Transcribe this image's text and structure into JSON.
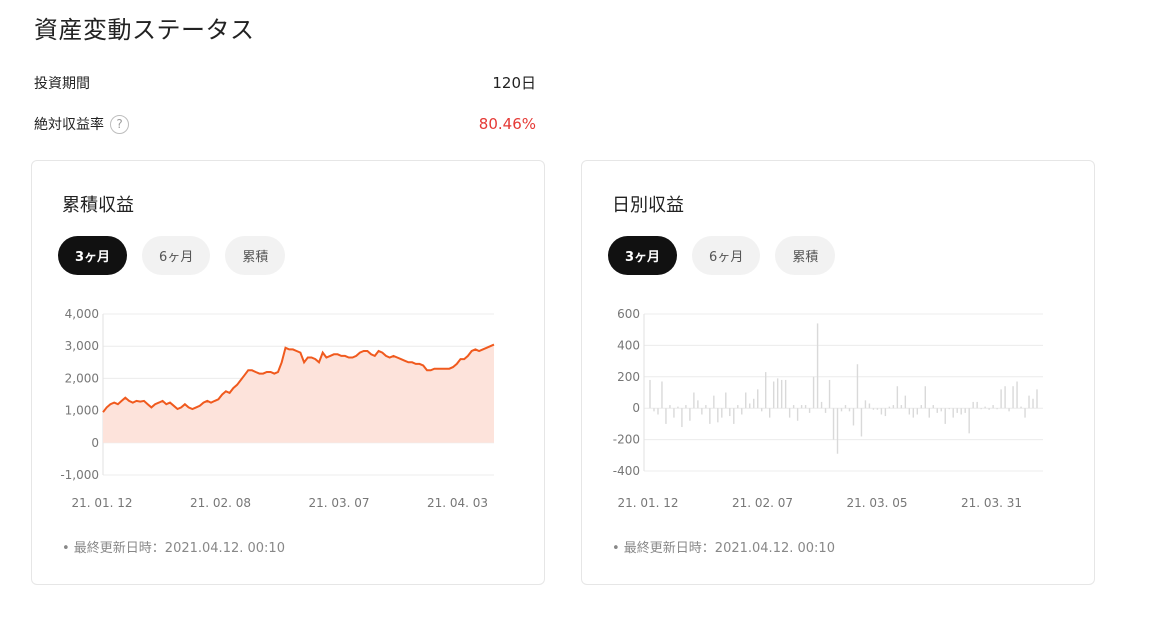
{
  "page_title": "資産変動ステータス",
  "summary": {
    "period_label": "投資期間",
    "period_value": "120日",
    "return_label": "絶対収益率",
    "return_help": "?",
    "return_value": "80.46%"
  },
  "tabs": [
    "3ヶ月",
    "6ヶ月",
    "累積"
  ],
  "left_card": {
    "title": "累積収益",
    "active_tab": "3ヶ月",
    "footnote": "• 最終更新日時：2021.04.12. 00:10"
  },
  "right_card": {
    "title": "日別収益",
    "active_tab": "3ヶ月",
    "footnote": "• 最終更新日時：2021.04.12. 00:10"
  },
  "chart_data": [
    {
      "type": "area",
      "ylim": [
        -1000,
        4000
      ],
      "y_ticks": [
        "4,000",
        "3,000",
        "2,000",
        "1,000",
        "0",
        "-1,000"
      ],
      "x_ticks": [
        "21. 01. 12",
        "21. 02. 08",
        "21. 03. 07",
        "21. 04. 03"
      ],
      "color": "#f05a1e",
      "fill": "#fde3db",
      "values": [
        950,
        1100,
        1200,
        1250,
        1200,
        1300,
        1400,
        1300,
        1250,
        1300,
        1280,
        1300,
        1200,
        1100,
        1200,
        1250,
        1300,
        1200,
        1250,
        1150,
        1050,
        1100,
        1200,
        1100,
        1050,
        1100,
        1150,
        1250,
        1300,
        1250,
        1300,
        1350,
        1500,
        1600,
        1550,
        1700,
        1800,
        1950,
        2100,
        2250,
        2250,
        2200,
        2150,
        2150,
        2200,
        2200,
        2150,
        2200,
        2500,
        2950,
        2900,
        2900,
        2850,
        2800,
        2500,
        2650,
        2650,
        2600,
        2500,
        2800,
        2650,
        2700,
        2750,
        2750,
        2700,
        2700,
        2650,
        2650,
        2700,
        2800,
        2850,
        2850,
        2750,
        2700,
        2850,
        2800,
        2700,
        2650,
        2700,
        2650,
        2600,
        2550,
        2500,
        2500,
        2450,
        2450,
        2400,
        2250,
        2250,
        2300,
        2300,
        2300,
        2300,
        2300,
        2350,
        2450,
        2600,
        2600,
        2700,
        2850,
        2900,
        2850,
        2900,
        2950,
        3000,
        3050
      ]
    },
    {
      "type": "bar",
      "ylim": [
        -400,
        600
      ],
      "y_ticks": [
        "600",
        "400",
        "200",
        "0",
        "-200",
        "-400"
      ],
      "x_ticks": [
        "21. 01. 12",
        "21. 02. 07",
        "21. 03. 05",
        "21. 03. 31"
      ],
      "color": "#d9d9d9",
      "values": [
        180,
        -20,
        -40,
        170,
        -100,
        20,
        -60,
        10,
        -120,
        20,
        -80,
        100,
        50,
        -40,
        20,
        -100,
        80,
        -90,
        -60,
        100,
        -50,
        -100,
        20,
        -40,
        100,
        30,
        60,
        120,
        -20,
        230,
        -60,
        170,
        190,
        180,
        180,
        -60,
        20,
        -80,
        20,
        20,
        -30,
        200,
        540,
        40,
        -30,
        180,
        -200,
        -290,
        -20,
        20,
        -20,
        -110,
        280,
        -180,
        50,
        30,
        -10,
        -10,
        -40,
        -50,
        10,
        20,
        140,
        20,
        80,
        -40,
        -60,
        -40,
        20,
        140,
        -60,
        20,
        -30,
        -20,
        -100,
        0,
        -60,
        -30,
        -40,
        -30,
        -160,
        40,
        40,
        0,
        10,
        -10,
        20,
        0,
        120,
        140,
        -20,
        140,
        170,
        10,
        -60,
        80,
        60,
        120
      ]
    }
  ]
}
